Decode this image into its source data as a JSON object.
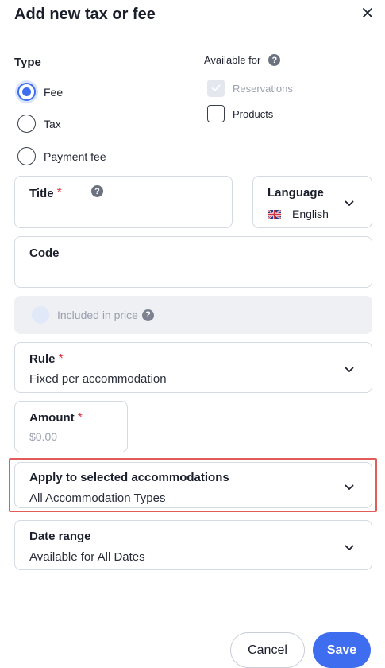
{
  "header": {
    "title": "Add new tax or fee",
    "close_icon": "close-icon"
  },
  "type_section": {
    "label": "Type",
    "options": [
      {
        "label": "Fee",
        "checked": true
      },
      {
        "label": "Tax",
        "checked": false
      },
      {
        "label": "Payment fee",
        "checked": false
      }
    ]
  },
  "available_for": {
    "label": "Available for",
    "options": [
      {
        "label": "Reservations",
        "checked": true,
        "disabled": true
      },
      {
        "label": "Products",
        "checked": false,
        "disabled": false
      }
    ]
  },
  "title_field": {
    "label": "Title",
    "required_mark": "*",
    "value": ""
  },
  "language_field": {
    "label": "Language",
    "value": "English",
    "flag_icon": "uk-flag-icon"
  },
  "code_field": {
    "label": "Code",
    "value": ""
  },
  "included_in_price": {
    "label": "Included in price",
    "enabled": false
  },
  "rule_field": {
    "label": "Rule",
    "required_mark": "*",
    "value": "Fixed per accommodation"
  },
  "amount_field": {
    "label": "Amount",
    "required_mark": "*",
    "placeholder": "$0.00"
  },
  "accommodations_field": {
    "label": "Apply to selected accommodations",
    "value": "All Accommodation Types"
  },
  "date_range_field": {
    "label": "Date range",
    "value": "Available for All Dates"
  },
  "footer": {
    "cancel_label": "Cancel",
    "save_label": "Save"
  },
  "colors": {
    "accent": "#3f6df0",
    "required": "#e0333f",
    "highlight_border": "#e25c5c"
  }
}
